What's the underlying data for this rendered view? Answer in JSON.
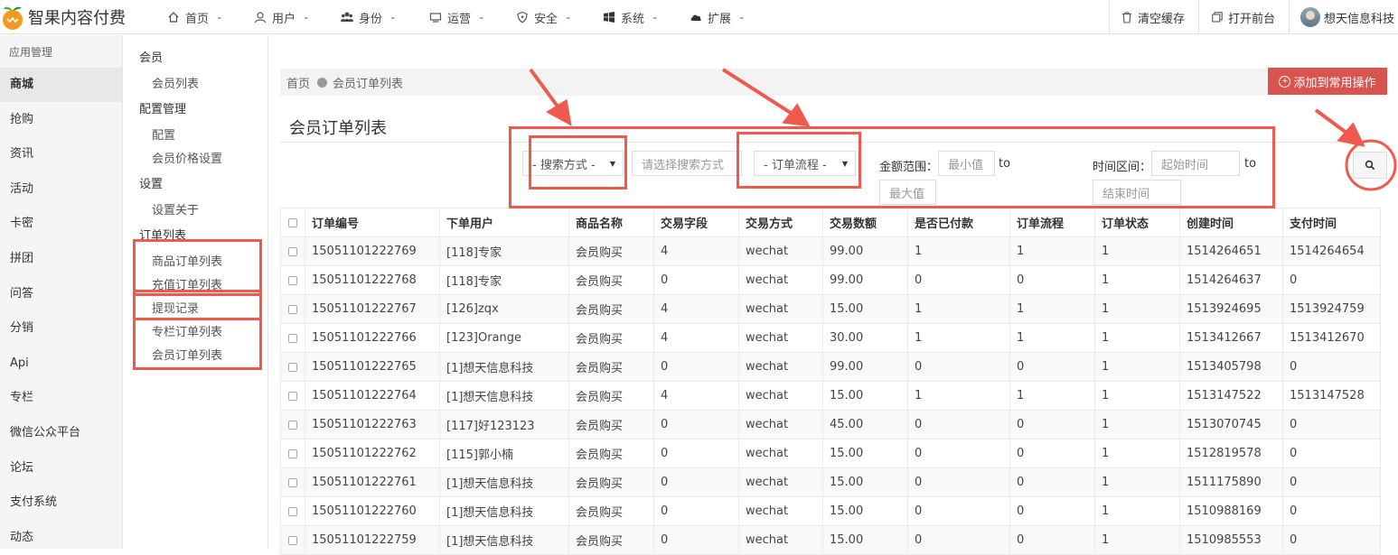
{
  "app": {
    "logo_text": "智果内容付费"
  },
  "nav": [
    {
      "label": "首页",
      "icon": "home-icon"
    },
    {
      "label": "用户",
      "icon": "user-icon"
    },
    {
      "label": "身份",
      "icon": "users-icon"
    },
    {
      "label": "运营",
      "icon": "monitor-icon"
    },
    {
      "label": "安全",
      "icon": "shield-icon"
    },
    {
      "label": "系统",
      "icon": "windows-icon"
    },
    {
      "label": "扩展",
      "icon": "cloud-icon"
    }
  ],
  "top_right": {
    "clear_cache": "清空缓存",
    "open_front": "打开前台",
    "user_name": "想天信息科技"
  },
  "sidebar": {
    "heading": "应用管理",
    "items": [
      "商城",
      "抢购",
      "资讯",
      "活动",
      "卡密",
      "拼团",
      "问答",
      "分销",
      "Api",
      "专栏",
      "微信公众平台",
      "论坛",
      "支付系统",
      "动态"
    ],
    "active_index": 0
  },
  "submenu": {
    "groups": [
      {
        "title": "会员",
        "items": [
          "会员列表"
        ]
      },
      {
        "title": "配置管理",
        "items": [
          "配置",
          "会员价格设置"
        ]
      },
      {
        "title": "设置",
        "items": [
          "设置关于"
        ]
      },
      {
        "title": "订单列表",
        "items": [
          "商品订单列表",
          "充值订单列表",
          "提现记录",
          "专栏订单列表",
          "会员订单列表"
        ]
      }
    ]
  },
  "breadcrumb": {
    "home": "首页",
    "current": "会员订单列表"
  },
  "add_button": "添加到常用操作",
  "page_title": "会员订单列表",
  "filters": {
    "search_mode": "- 搜索方式 -",
    "search_input_placeholder": "请选择搜索方式",
    "order_flow": "- 订单流程 -",
    "amount_label": "金额范围：",
    "min_placeholder": "最小值",
    "to1": "to",
    "max_placeholder": "最大值",
    "time_label": "时间区间：",
    "start_placeholder": "起始时间",
    "to2": "to",
    "end_placeholder": "结束时间"
  },
  "table": {
    "columns": [
      "订单编号",
      "下单用户",
      "商品名称",
      "交易字段",
      "交易方式",
      "交易数额",
      "是否已付款",
      "订单流程",
      "订单状态",
      "创建时间",
      "支付时间"
    ],
    "rows": [
      [
        "15051101222769",
        "[118]专家",
        "会员购买",
        "4",
        "wechat",
        "99.00",
        "1",
        "1",
        "1",
        "1514264651",
        "1514264654"
      ],
      [
        "15051101222768",
        "[118]专家",
        "会员购买",
        "0",
        "wechat",
        "99.00",
        "0",
        "0",
        "1",
        "1514264637",
        "0"
      ],
      [
        "15051101222767",
        "[126]zqx",
        "会员购买",
        "4",
        "wechat",
        "15.00",
        "1",
        "1",
        "1",
        "1513924695",
        "1513924759"
      ],
      [
        "15051101222766",
        "[123]Orange",
        "会员购买",
        "4",
        "wechat",
        "30.00",
        "1",
        "1",
        "1",
        "1513412667",
        "1513412670"
      ],
      [
        "15051101222765",
        "[1]想天信息科技",
        "会员购买",
        "0",
        "wechat",
        "99.00",
        "0",
        "0",
        "1",
        "1513405798",
        "0"
      ],
      [
        "15051101222764",
        "[1]想天信息科技",
        "会员购买",
        "4",
        "wechat",
        "15.00",
        "1",
        "1",
        "1",
        "1513147522",
        "1513147528"
      ],
      [
        "15051101222763",
        "[117]好123123",
        "会员购买",
        "0",
        "wechat",
        "45.00",
        "0",
        "0",
        "1",
        "1513070745",
        "0"
      ],
      [
        "15051101222762",
        "[115]郭小楠",
        "会员购买",
        "0",
        "wechat",
        "15.00",
        "0",
        "0",
        "1",
        "1512819578",
        "0"
      ],
      [
        "15051101222761",
        "[1]想天信息科技",
        "会员购买",
        "0",
        "wechat",
        "15.00",
        "0",
        "0",
        "1",
        "1511175890",
        "0"
      ],
      [
        "15051101222760",
        "[1]想天信息科技",
        "会员购买",
        "0",
        "wechat",
        "15.00",
        "0",
        "0",
        "1",
        "1510988169",
        "0"
      ],
      [
        "15051101222759",
        "[1]想天信息科技",
        "会员购买",
        "0",
        "wechat",
        "15.00",
        "0",
        "0",
        "1",
        "1510985553",
        "0"
      ]
    ]
  },
  "colors": {
    "accent_red": "#d9534f",
    "annotation_red": "#f05a4e",
    "logo_orange": "#f39a1e",
    "logo_green": "#4caf50"
  }
}
